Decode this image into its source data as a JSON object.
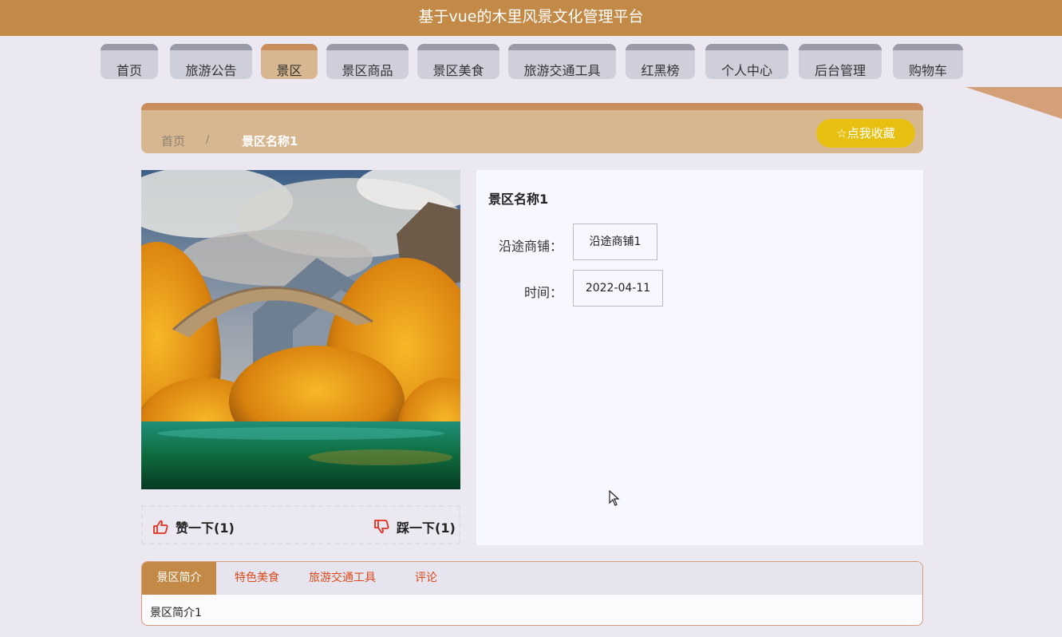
{
  "header": {
    "title": "基于vue的木里风景文化管理平台"
  },
  "nav": {
    "items": [
      {
        "label": "首页"
      },
      {
        "label": "旅游公告"
      },
      {
        "label": "景区"
      },
      {
        "label": "景区商品"
      },
      {
        "label": "景区美食"
      },
      {
        "label": "旅游交通工具"
      },
      {
        "label": "红黑榜"
      },
      {
        "label": "个人中心"
      },
      {
        "label": "后台管理"
      },
      {
        "label": "购物车"
      }
    ],
    "active_index": 2
  },
  "breadcrumb": {
    "home": "首页",
    "separator": "/",
    "current": "景区名称1"
  },
  "favorite": {
    "label": "点我收藏",
    "icon": "star-icon"
  },
  "detail": {
    "title": "景区名称1",
    "fields": [
      {
        "label": "沿途商铺：",
        "value": "沿途商铺1"
      },
      {
        "label": "时间：",
        "value": "2022-04-11"
      }
    ]
  },
  "votes": {
    "like": {
      "label": "赞一下(1)",
      "icon": "thumbs-up-icon"
    },
    "dislike": {
      "label": "踩一下(1)",
      "icon": "thumbs-down-icon"
    }
  },
  "tabs": {
    "items": [
      {
        "label": "景区简介"
      },
      {
        "label": "特色美食"
      },
      {
        "label": "旅游交通工具"
      },
      {
        "label": "评论"
      }
    ],
    "active_index": 0,
    "content": "景区简介1"
  },
  "colors": {
    "header": "#c38a47",
    "nav_active": "#d6b78f",
    "favorite_button": "#e8c012",
    "tab_text": "#d94a18",
    "vote_icon": "#e0301e"
  }
}
